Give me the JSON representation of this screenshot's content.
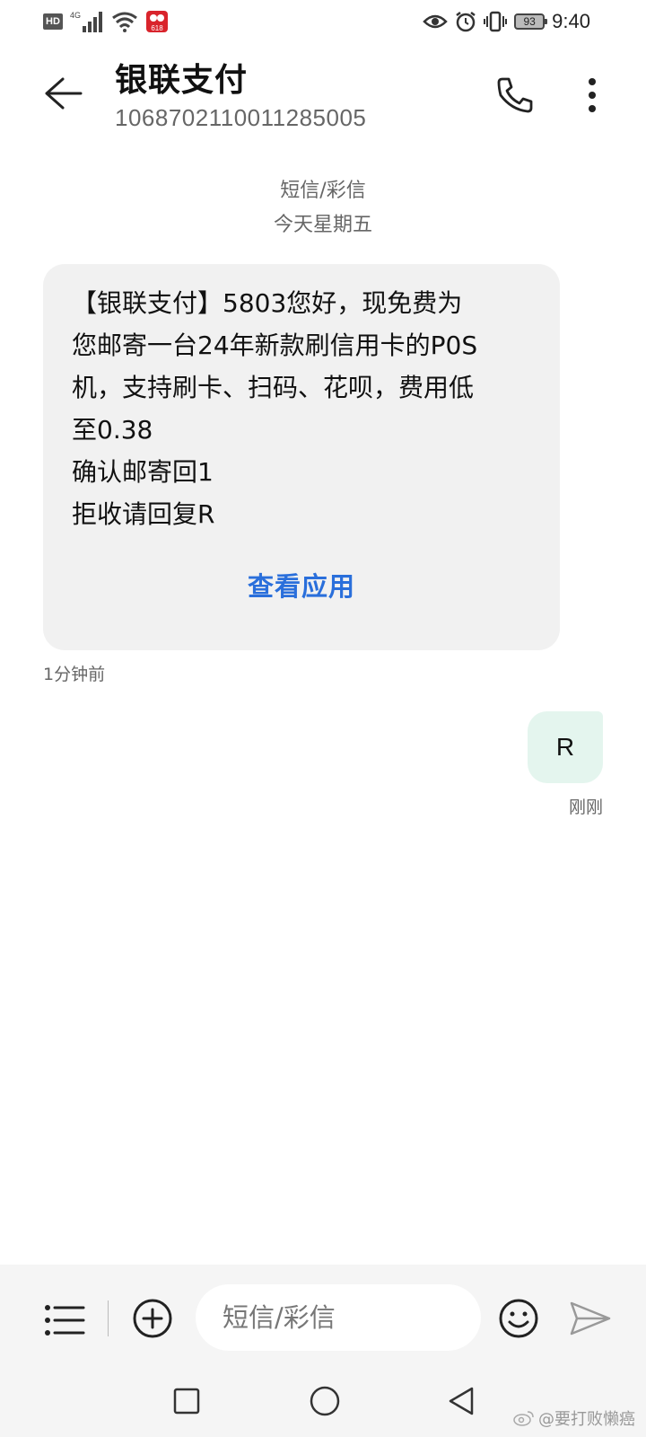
{
  "status_bar": {
    "hd": "HD",
    "network": "4G",
    "event_badge": "618",
    "battery": "93",
    "time": "9:40"
  },
  "header": {
    "contact_name": "银联支付",
    "contact_number": "106870211001128500​5"
  },
  "thread": {
    "type_label": "短信/彩信",
    "date_label": "今天星期五"
  },
  "incoming_message": {
    "lines": [
      "【银联支付】5803您好，现免费为",
      "您邮寄一台24年新款刷信用卡的P0S",
      "机，支持刷卡、扫码、花呗，费用低",
      "至0.38",
      "确认邮寄回1",
      "拒收请回复R"
    ],
    "action_label": "查看应用",
    "time": "1分钟前"
  },
  "outgoing_message": {
    "text": "R",
    "time": "刚刚"
  },
  "composer": {
    "placeholder": "短信/彩信",
    "value": ""
  },
  "watermark": {
    "text": "@要打败懒癌"
  },
  "colors": {
    "accent": "#2a6fdb",
    "incoming_bubble": "#f1f1f1",
    "outgoing_bubble": "#e4f5ee",
    "composer_bg": "#f5f5f5"
  }
}
